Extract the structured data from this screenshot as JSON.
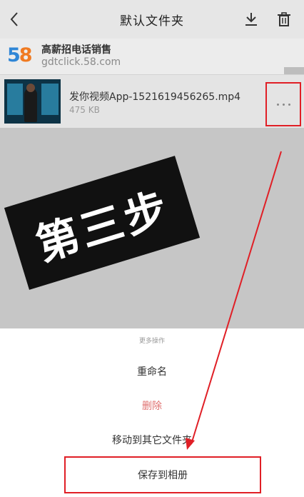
{
  "header": {
    "title": "默认文件夹",
    "back_icon": "back-chevron-icon",
    "download_icon": "download-icon",
    "trash_icon": "trash-icon"
  },
  "ad": {
    "logo_text_a": "5",
    "logo_text_b": "8",
    "title": "高薪招电话销售",
    "url": "gdtclick.58.com"
  },
  "file": {
    "name": "发你视频App-1521619456265.mp4",
    "size": "475 KB",
    "more_icon": "more-dots-icon"
  },
  "annotation": {
    "step_label": "第三步",
    "highlight_color": "#e01f26"
  },
  "action_sheet": {
    "title": "更多操作",
    "rename": "重命名",
    "delete": "删除",
    "move": "移动到其它文件夹",
    "save": "保存到相册"
  }
}
